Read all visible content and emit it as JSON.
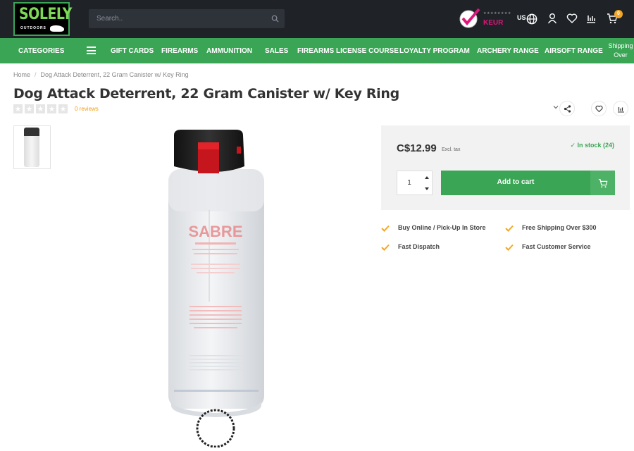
{
  "header": {
    "logo_text": "SOLELY",
    "logo_sub": "OUTDOORS",
    "search_placeholder": "Search..",
    "keur_label": "KEUR",
    "keur_stars": "★★★★★★★★",
    "language": "US",
    "cart_count": "0"
  },
  "nav": {
    "categories": "CATEGORIES",
    "items": [
      "GIFT CARDS",
      "FIREARMS",
      "AMMUNITION",
      "SALES",
      "FIREARMS LICENSE COURSE",
      "LOYALTY PROGRAM",
      "ARCHERY RANGE",
      "AIRSOFT RANGE"
    ],
    "overflow_label": "Shipping Over"
  },
  "breadcrumb": [
    "Home",
    "Dog Attack Deterrent, 22 Gram Canister w/ Key Ring"
  ],
  "product": {
    "title": "Dog Attack Deterrent, 22 Gram Canister w/ Key Ring",
    "rating": 0,
    "reviews": "0 reviews",
    "price": "C$12.99",
    "tax_note": "Excl. tax",
    "stock": "In stock (24)",
    "quantity": "1",
    "add_to_cart": "Add to cart",
    "image_brand_text": "SABRE"
  },
  "usps": [
    "Buy Online / Pick-Up In Store",
    "Free Shipping Over $300",
    "Fast Dispatch",
    "Fast Customer Service"
  ],
  "colors": {
    "accent_green": "#3aa655",
    "header_dark": "#1f2328",
    "check_orange": "#f5a623",
    "review_orange": "#f39c12"
  }
}
